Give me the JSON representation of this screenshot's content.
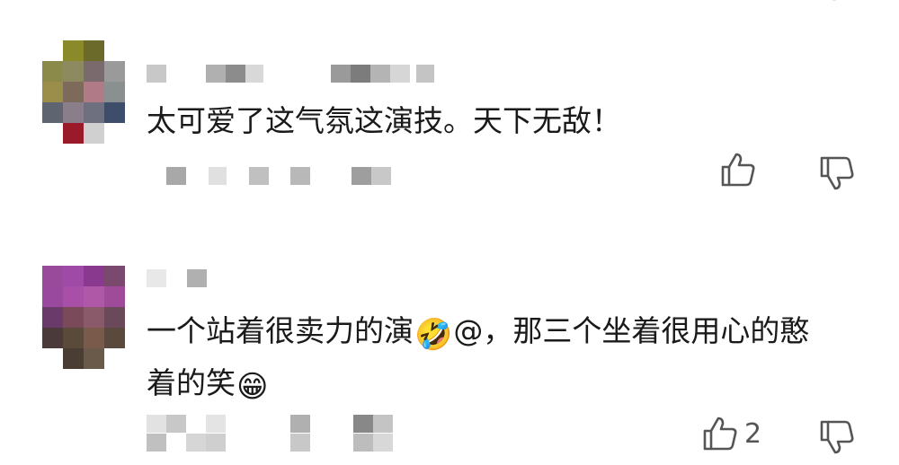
{
  "comments": [
    {
      "text": "太可爱了这气氛这演技。天下无敌！",
      "like_count": "",
      "like_icon": "thumbs-up-outline",
      "dislike_icon": "thumbs-down-outline"
    },
    {
      "text_part1": "一个站着很卖力的演",
      "emoji1": "🤣",
      "text_part2": "@，那三个坐着很用心的憨",
      "text_line2": "着的笑",
      "emoji2": "😁",
      "like_count": "2",
      "like_icon": "thumbs-up-outline",
      "dislike_icon": "thumbs-down-outline"
    }
  ],
  "colors": {
    "text": "#1a1a1a",
    "icon": "#555555",
    "pixelated_gray": "#b8b8b8"
  }
}
